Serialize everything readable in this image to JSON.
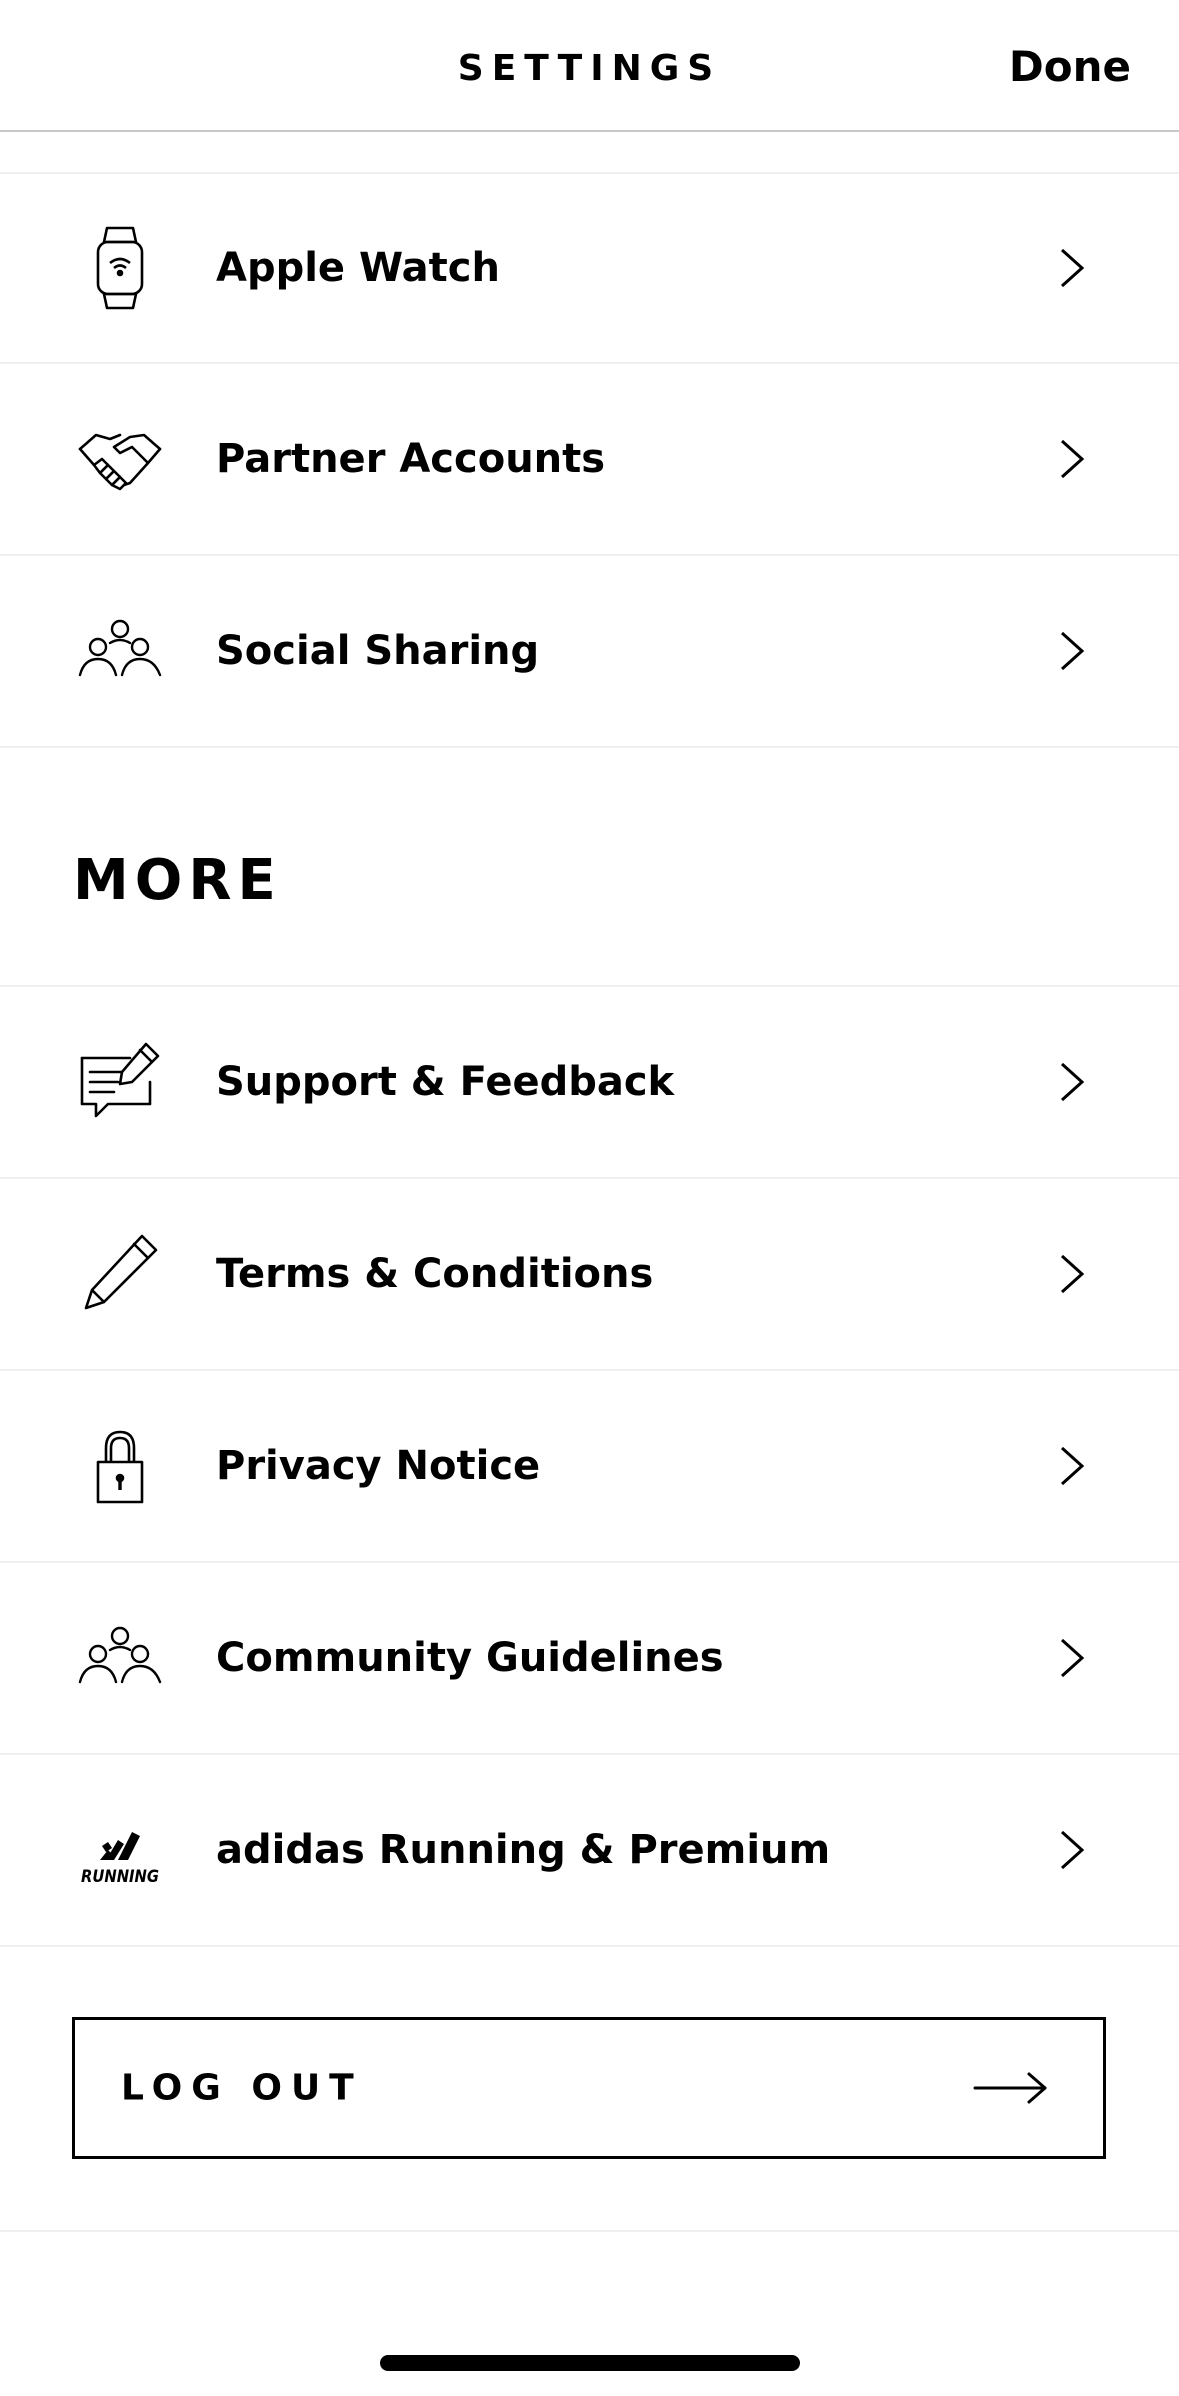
{
  "header": {
    "title": "SETTINGS",
    "done_label": "Done"
  },
  "connections": {
    "items": [
      {
        "label": "Apple Watch",
        "icon": "apple-watch-icon"
      },
      {
        "label": "Partner Accounts",
        "icon": "handshake-icon"
      },
      {
        "label": "Social Sharing",
        "icon": "people-group-icon"
      }
    ]
  },
  "more": {
    "heading": "MORE",
    "items": [
      {
        "label": "Support & Feedback",
        "icon": "feedback-form-icon"
      },
      {
        "label": "Terms & Conditions",
        "icon": "pencil-icon"
      },
      {
        "label": "Privacy Notice",
        "icon": "lock-icon"
      },
      {
        "label": "Community Guidelines",
        "icon": "people-group-icon"
      },
      {
        "label": "adidas Running & Premium",
        "icon": "adidas-running-logo",
        "logo_text": "RUNNING"
      }
    ]
  },
  "logout": {
    "label": "LOG OUT",
    "icon": "arrow-right-icon"
  },
  "colors": {
    "text": "#000000",
    "background": "#ffffff",
    "divider": "#efefef"
  }
}
